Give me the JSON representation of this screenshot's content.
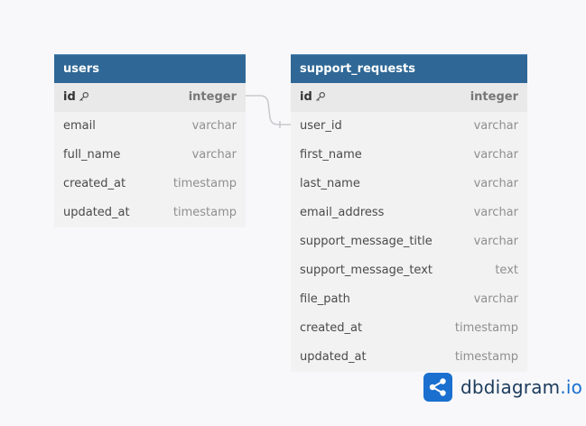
{
  "tables": {
    "users": {
      "name": "users",
      "columns": [
        {
          "name": "id",
          "type": "integer",
          "pk": true
        },
        {
          "name": "email",
          "type": "varchar"
        },
        {
          "name": "full_name",
          "type": "varchar"
        },
        {
          "name": "created_at",
          "type": "timestamp"
        },
        {
          "name": "updated_at",
          "type": "timestamp"
        }
      ]
    },
    "support_requests": {
      "name": "support_requests",
      "columns": [
        {
          "name": "id",
          "type": "integer",
          "pk": true
        },
        {
          "name": "user_id",
          "type": "varchar"
        },
        {
          "name": "first_name",
          "type": "varchar"
        },
        {
          "name": "last_name",
          "type": "varchar"
        },
        {
          "name": "email_address",
          "type": "varchar"
        },
        {
          "name": "support_message_title",
          "type": "varchar"
        },
        {
          "name": "support_message_text",
          "type": "text"
        },
        {
          "name": "file_path",
          "type": "varchar"
        },
        {
          "name": "created_at",
          "type": "timestamp"
        },
        {
          "name": "updated_at",
          "type": "timestamp"
        }
      ]
    }
  },
  "relationship": {
    "from": "users.id",
    "to": "support_requests.user_id"
  },
  "branding": {
    "logo_main": "dbdiagram",
    "logo_suffix": ".io",
    "accent_color": "#1a6fcf",
    "header_color": "#2f6896"
  }
}
